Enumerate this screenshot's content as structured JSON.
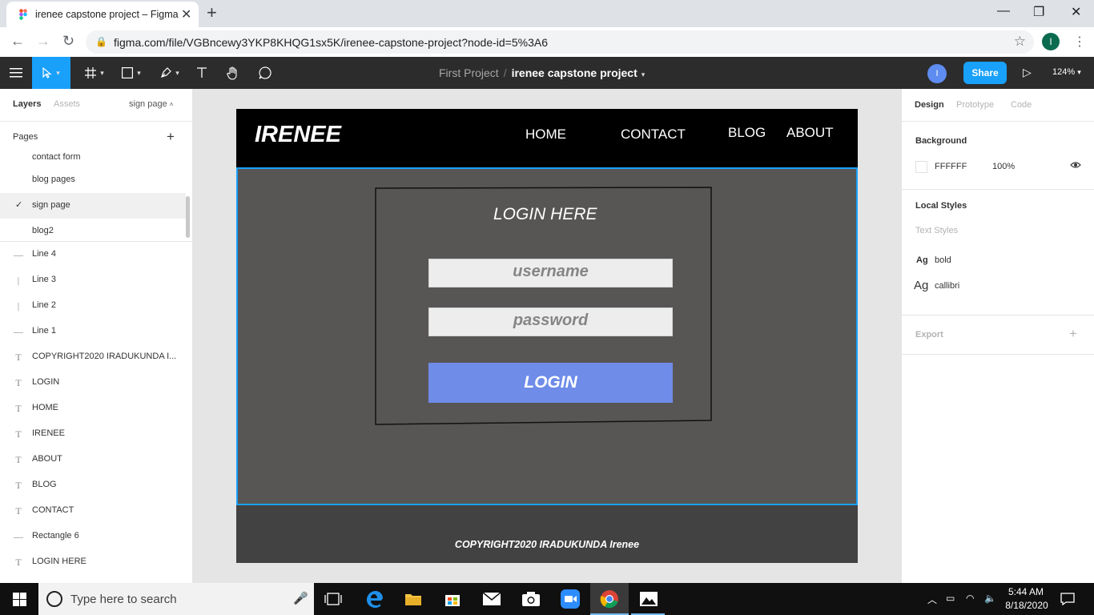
{
  "browser": {
    "tab_title": "irenee capstone project – Figma",
    "url": "figma.com/file/VGBncewy3YKP8KHQG1sx5K/irenee-capstone-project?node-id=5%3A6",
    "profile_initial": "I"
  },
  "toolbar": {
    "project": "First Project",
    "separator": "/",
    "file_name": "irenee capstone project",
    "user_initial": "I",
    "share_label": "Share",
    "zoom": "124%"
  },
  "left_panel": {
    "tab_layers": "Layers",
    "tab_assets": "Assets",
    "current_page": "sign page",
    "pages_header": "Pages",
    "pages": [
      {
        "label": "contact form"
      },
      {
        "label": "blog pages"
      },
      {
        "label": "sign page",
        "selected": true
      },
      {
        "label": "blog2"
      }
    ],
    "layers": [
      {
        "label": "Line 4",
        "icon": "line-horizontal-icon"
      },
      {
        "label": "Line 3",
        "icon": "line-vertical-icon"
      },
      {
        "label": "Line 2",
        "icon": "line-vertical-icon"
      },
      {
        "label": "Line 1",
        "icon": "line-horizontal-icon"
      },
      {
        "label": "COPYRIGHT2020 IRADUKUNDA I...",
        "icon": "text-icon"
      },
      {
        "label": "LOGIN",
        "icon": "text-icon"
      },
      {
        "label": "HOME",
        "icon": "text-icon"
      },
      {
        "label": "IRENEE",
        "icon": "text-icon"
      },
      {
        "label": "ABOUT",
        "icon": "text-icon"
      },
      {
        "label": "BLOG",
        "icon": "text-icon"
      },
      {
        "label": "CONTACT",
        "icon": "text-icon"
      },
      {
        "label": "Rectangle 6",
        "icon": "line-horizontal-icon"
      },
      {
        "label": "LOGIN HERE",
        "icon": "text-icon"
      }
    ]
  },
  "canvas": {
    "brand": "IRENEE",
    "nav": {
      "home": "HOME",
      "contact": "CONTACT",
      "blog": "BLOG",
      "about": "ABOUT"
    },
    "login_title": "LOGIN HERE",
    "username_placeholder": "username",
    "password_placeholder": "password",
    "login_button": "LOGIN",
    "copyright": "COPYRIGHT2020 IRADUKUNDA Irenee",
    "help": "?"
  },
  "right_panel": {
    "tab_design": "Design",
    "tab_prototype": "Prototype",
    "tab_code": "Code",
    "background_header": "Background",
    "background_hex": "FFFFFF",
    "background_opacity": "100%",
    "local_styles_header": "Local Styles",
    "text_styles_label": "Text Styles",
    "style_ag": "Ag",
    "styles": [
      {
        "name": "bold"
      },
      {
        "name": "callibri"
      }
    ],
    "export_label": "Export"
  },
  "taskbar": {
    "search_placeholder": "Type here to search",
    "time": "5:44 AM",
    "date": "8/18/2020"
  },
  "colors": {
    "figma_toolbar": "#2c2c2c",
    "share_blue": "#18a0fb",
    "login_button": "#6e8ce8",
    "frame_body": "#585655",
    "frame_footer": "#424242"
  }
}
